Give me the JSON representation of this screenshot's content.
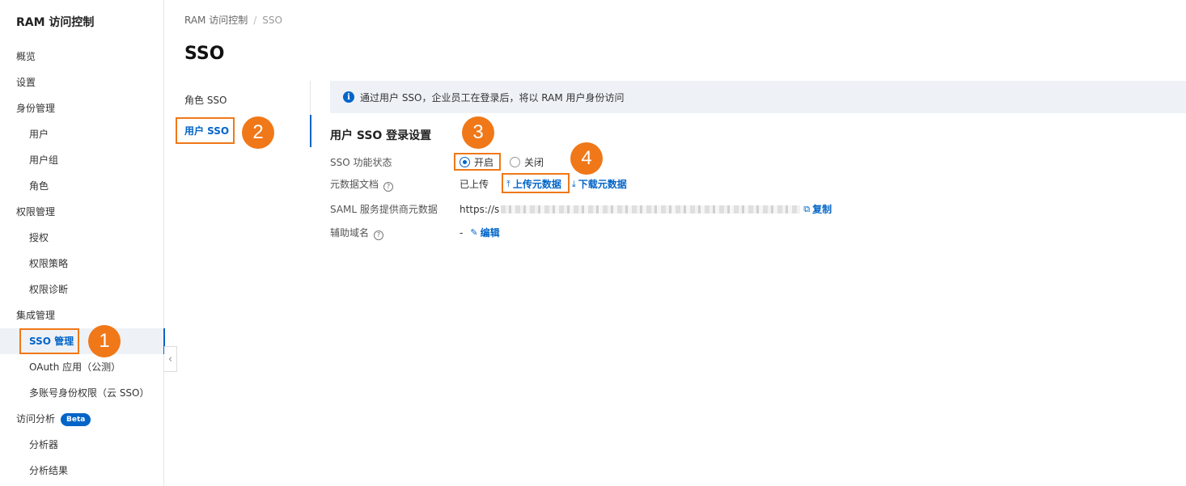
{
  "sidebar": {
    "title": "RAM 访问控制",
    "items": [
      {
        "label": "概览",
        "level": 0
      },
      {
        "label": "设置",
        "level": 0
      },
      {
        "label": "身份管理",
        "level": 0
      },
      {
        "label": "用户",
        "level": 1
      },
      {
        "label": "用户组",
        "level": 1
      },
      {
        "label": "角色",
        "level": 1
      },
      {
        "label": "权限管理",
        "level": 0
      },
      {
        "label": "授权",
        "level": 1
      },
      {
        "label": "权限策略",
        "level": 1
      },
      {
        "label": "权限诊断",
        "level": 1
      },
      {
        "label": "集成管理",
        "level": 0
      },
      {
        "label": "SSO 管理",
        "level": 1,
        "active": true
      },
      {
        "label": "OAuth 应用（公测）",
        "level": 1
      },
      {
        "label": "多账号身份权限（云 SSO）",
        "level": 1
      },
      {
        "label": "访问分析",
        "level": 0,
        "badge": "Beta"
      },
      {
        "label": "分析器",
        "level": 1
      },
      {
        "label": "分析结果",
        "level": 1
      }
    ]
  },
  "breadcrumb": {
    "root": "RAM 访问控制",
    "separator": "/",
    "current": "SSO"
  },
  "page_title": "SSO",
  "tabs": [
    {
      "label": "角色 SSO"
    },
    {
      "label": "用户 SSO",
      "active": true
    }
  ],
  "banner": {
    "text": "通过用户 SSO，企业员工在登录后，将以 RAM 用户身份访问"
  },
  "section_title": "用户 SSO 登录设置",
  "fields": {
    "status_label": "SSO 功能状态",
    "status_on": "开启",
    "status_off": "关闭",
    "metadata_label": "元数据文档",
    "metadata_value": "已上传",
    "upload_label": "上传元数据",
    "download_label": "下载元数据",
    "saml_label": "SAML 服务提供商元数据",
    "saml_prefix": "https://s",
    "copy_label": "复制",
    "domain_label": "辅助域名",
    "domain_value": "-",
    "edit_label": "编辑"
  },
  "annotations": {
    "m1": "1",
    "m2": "2",
    "m3": "3",
    "m4": "4",
    "color": "#f07818"
  },
  "colors": {
    "accent": "#0064c8",
    "banner_bg": "#eef2f7",
    "highlight": "#f07818"
  }
}
